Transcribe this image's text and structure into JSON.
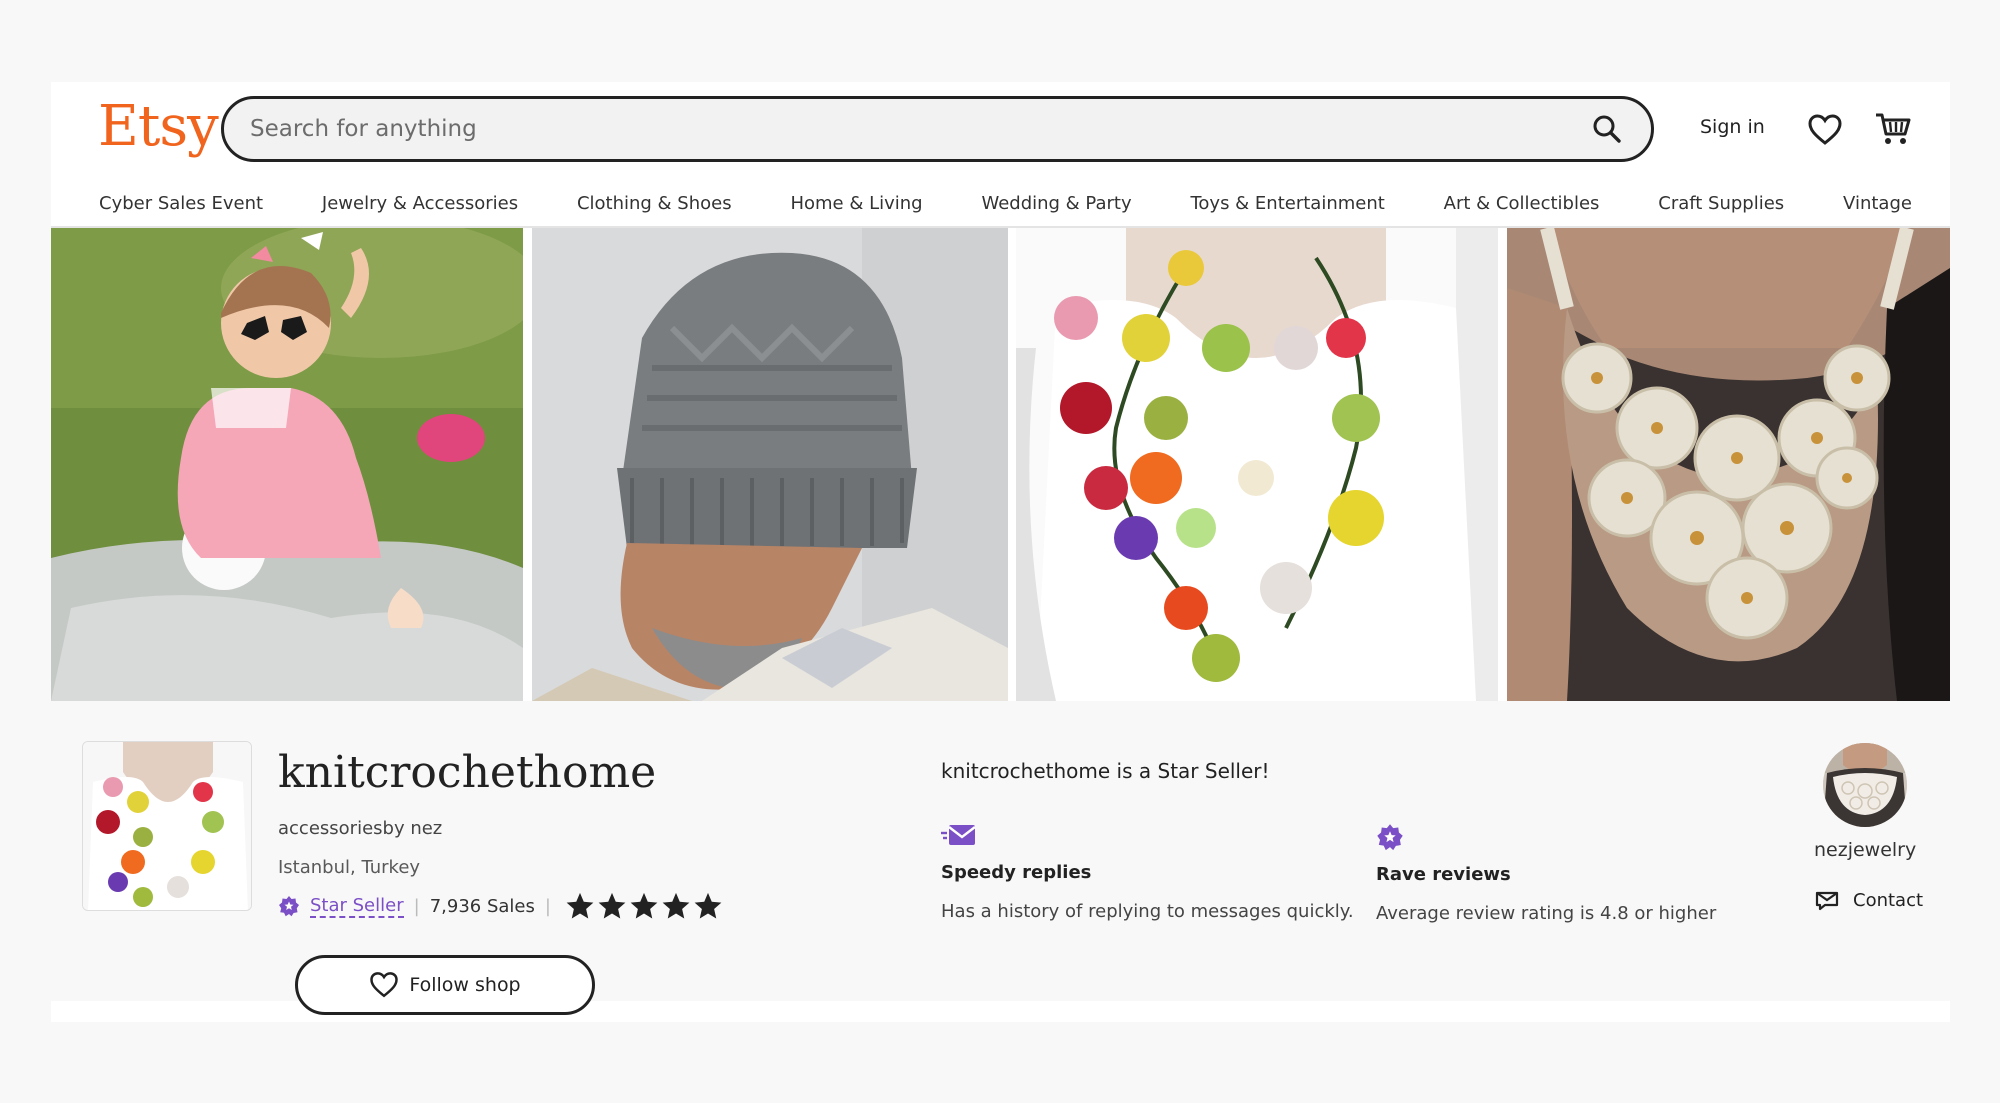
{
  "header": {
    "logo": "Etsy",
    "search_placeholder": "Search for anything",
    "sign_in": "Sign in"
  },
  "categories": [
    "Cyber Sales Event",
    "Jewelry & Accessories",
    "Clothing & Shoes",
    "Home & Living",
    "Wedding & Party",
    "Toys & Entertainment",
    "Art & Collectibles",
    "Craft Supplies",
    "Vintage"
  ],
  "shop": {
    "name": "knitcrochethome",
    "subtitle": "accessoriesby nez",
    "location": "Istanbul, Turkey",
    "star_seller_label": "Star Seller",
    "sales": "7,936 Sales",
    "rating_stars": 5,
    "follow_label": "Follow shop"
  },
  "star_seller": {
    "title": "knitcrochethome is a Star Seller!",
    "features": [
      {
        "title": "Speedy replies",
        "description": "Has a history of replying to messages quickly."
      },
      {
        "title": "Rave reviews",
        "description": "Average review rating is 4.8 or higher"
      }
    ]
  },
  "owner": {
    "name": "nezjewelry",
    "contact_label": "Contact"
  },
  "colors": {
    "brand": "#f1641e",
    "star_seller": "#7b4fc6"
  }
}
